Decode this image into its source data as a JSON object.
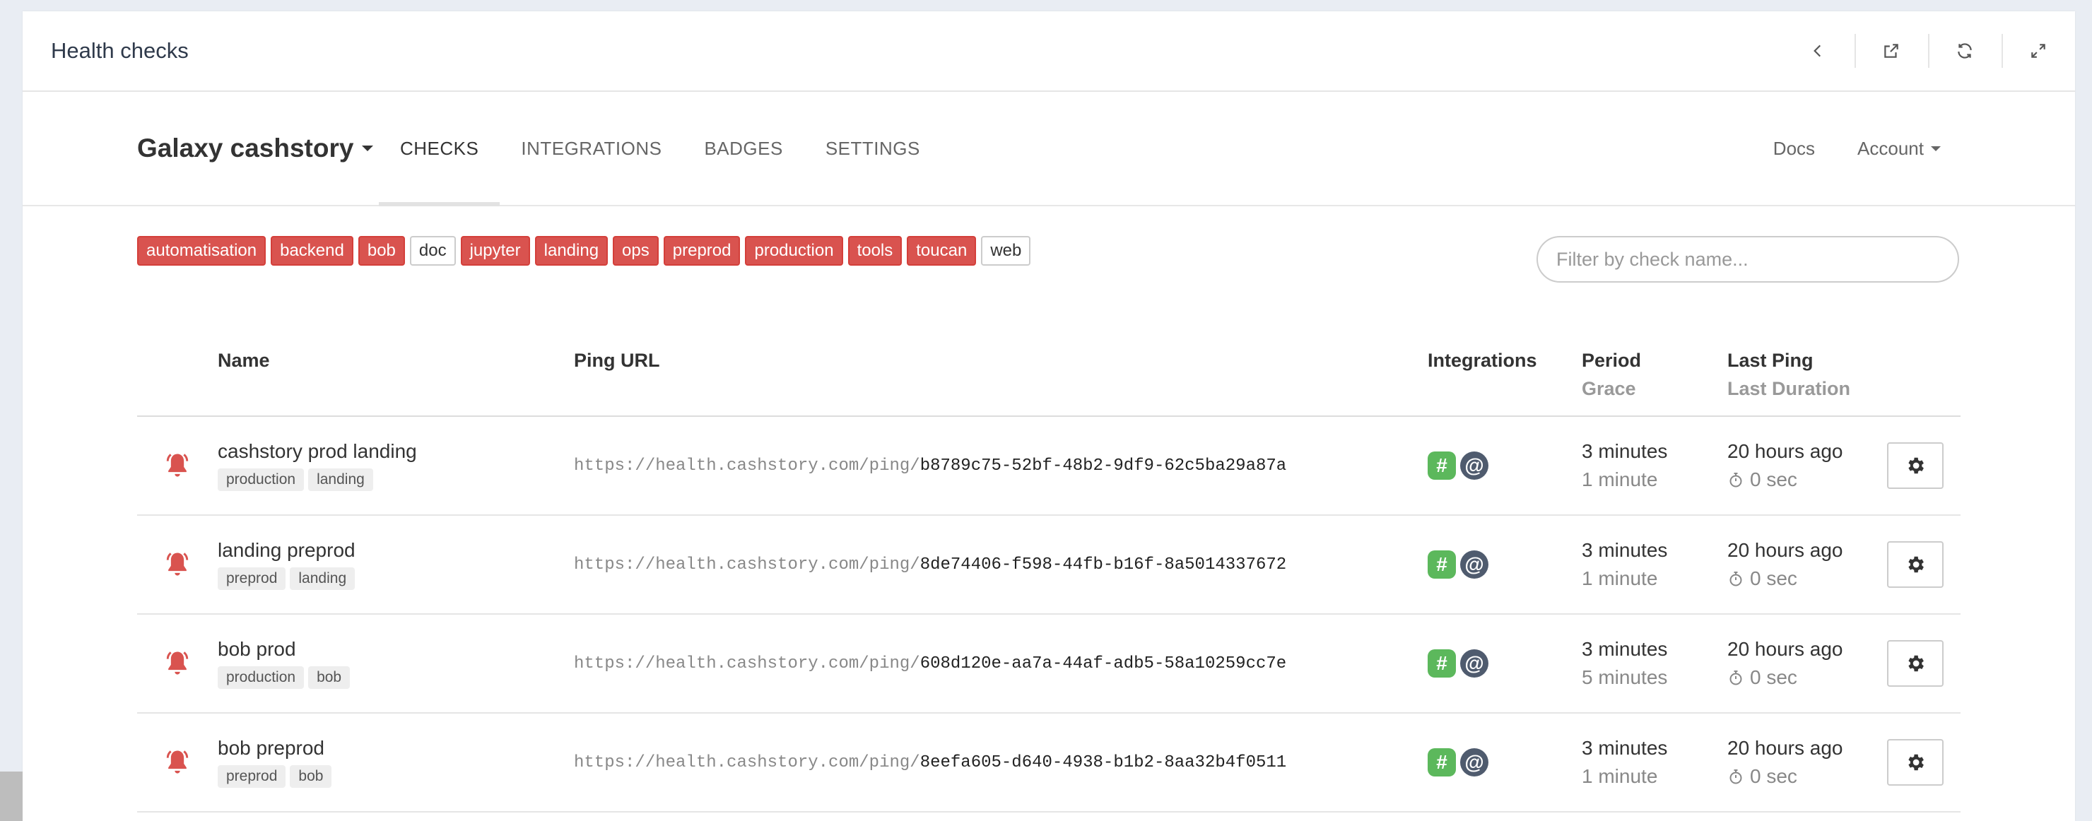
{
  "panel": {
    "title": "Health checks"
  },
  "toolbar": [
    "chevron-left-icon",
    "external-link-icon",
    "refresh-icon",
    "expand-icon"
  ],
  "brand": {
    "project": "Galaxy cashstory"
  },
  "nav": {
    "tabs": [
      "CHECKS",
      "INTEGRATIONS",
      "BADGES",
      "SETTINGS"
    ],
    "active": "CHECKS",
    "docs": "Docs",
    "account": "Account"
  },
  "tags": [
    {
      "label": "automatisation",
      "down": true
    },
    {
      "label": "backend",
      "down": true
    },
    {
      "label": "bob",
      "down": true
    },
    {
      "label": "doc",
      "down": false
    },
    {
      "label": "jupyter",
      "down": true
    },
    {
      "label": "landing",
      "down": true
    },
    {
      "label": "ops",
      "down": true
    },
    {
      "label": "preprod",
      "down": true
    },
    {
      "label": "production",
      "down": true
    },
    {
      "label": "tools",
      "down": true
    },
    {
      "label": "toucan",
      "down": true
    },
    {
      "label": "web",
      "down": false
    }
  ],
  "filter": {
    "placeholder": "Filter by check name..."
  },
  "table": {
    "headers": {
      "name": "Name",
      "ping_url": "Ping URL",
      "integrations": "Integrations",
      "period": "Period",
      "grace": "Grace",
      "last_ping": "Last Ping",
      "last_duration": "Last Duration"
    },
    "rows": [
      {
        "name": "cashstory prod landing",
        "tags": [
          "production",
          "landing"
        ],
        "url_base": "https://health.cashstory.com/ping/",
        "code": "b8789c75-52bf-48b2-9df9-62c5ba29a87a",
        "period": "3 minutes",
        "grace": "1 minute",
        "last_ping": "20 hours ago",
        "duration": "0 sec"
      },
      {
        "name": "landing preprod",
        "tags": [
          "preprod",
          "landing"
        ],
        "url_base": "https://health.cashstory.com/ping/",
        "code": "8de74406-f598-44fb-b16f-8a5014337672",
        "period": "3 minutes",
        "grace": "1 minute",
        "last_ping": "20 hours ago",
        "duration": "0 sec"
      },
      {
        "name": "bob prod",
        "tags": [
          "production",
          "bob"
        ],
        "url_base": "https://health.cashstory.com/ping/",
        "code": "608d120e-aa7a-44af-adb5-58a10259cc7e",
        "period": "3 minutes",
        "grace": "5 minutes",
        "last_ping": "20 hours ago",
        "duration": "0 sec"
      },
      {
        "name": "bob preprod",
        "tags": [
          "preprod",
          "bob"
        ],
        "url_base": "https://health.cashstory.com/ping/",
        "code": "8eefa605-d640-4938-b1b2-8aa32b4f0511",
        "period": "3 minutes",
        "grace": "1 minute",
        "last_ping": "20 hours ago",
        "duration": "0 sec"
      }
    ]
  },
  "colors": {
    "down": "#d9534f",
    "slack": "#5cb85c",
    "email": "#4f5b6e"
  }
}
